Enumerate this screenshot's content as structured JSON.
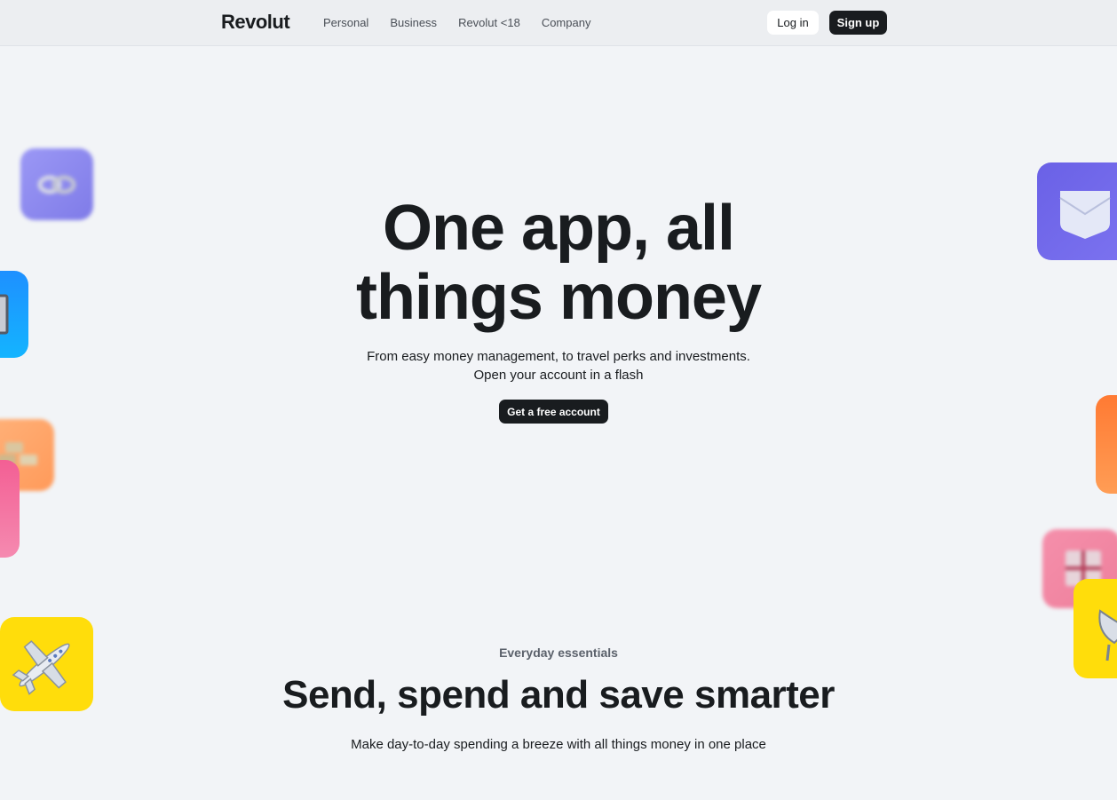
{
  "brand": {
    "logo_text": "Revolut"
  },
  "nav": {
    "items": [
      {
        "label": "Personal"
      },
      {
        "label": "Business"
      },
      {
        "label": "Revolut <18"
      },
      {
        "label": "Company"
      }
    ]
  },
  "header_actions": {
    "login_label": "Log in",
    "signup_label": "Sign up"
  },
  "hero": {
    "title_line1": "One app, all",
    "title_line2": "things money",
    "subtitle_line1": "From easy money management, to travel perks and investments.",
    "subtitle_line2": "Open your account in a flash",
    "cta_label": "Get a free account"
  },
  "essentials": {
    "eyebrow": "Everyday essentials",
    "title": "Send, spend and save smarter",
    "subtitle": "Make day-to-day spending a breeze with all things money in one place"
  },
  "tiles": [
    {
      "icon": "link-icon",
      "color": "#8f8cf0"
    },
    {
      "icon": "calculator-icon",
      "color": "#1aa0ff"
    },
    {
      "icon": "gold-bars-icon",
      "color": "#ffa56b"
    },
    {
      "icon": "pink-card-icon",
      "color": "#f26f9c"
    },
    {
      "icon": "airplane-icon",
      "color": "#ffdd0b"
    },
    {
      "icon": "envelope-icon",
      "color": "#6f65ea"
    },
    {
      "icon": "orange-card-icon",
      "color": "#ff8a3d"
    },
    {
      "icon": "gift-icon",
      "color": "#f28fa8"
    },
    {
      "icon": "satellite-icon",
      "color": "#ffdd0b"
    }
  ]
}
